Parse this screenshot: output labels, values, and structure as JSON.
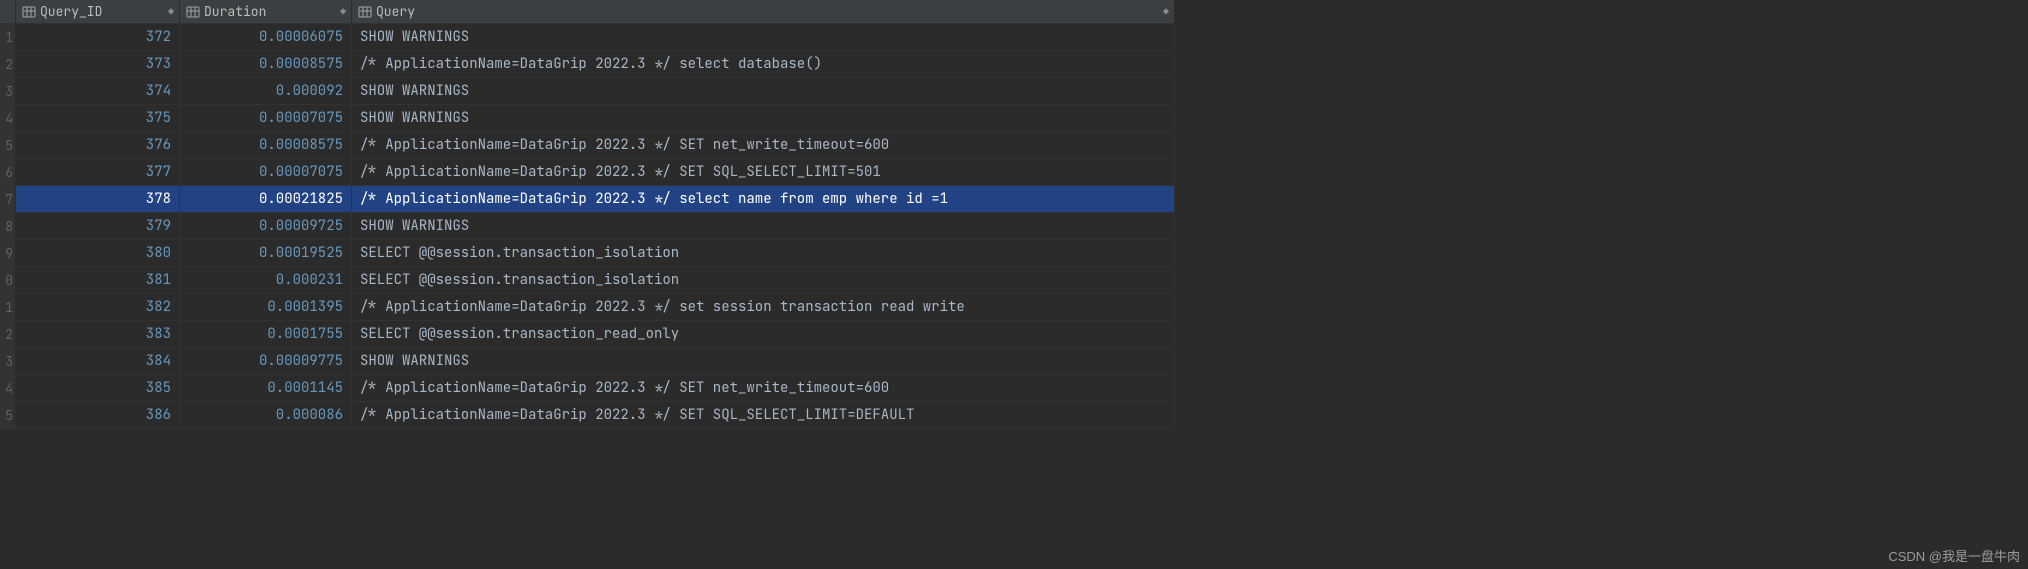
{
  "columns": {
    "query_id": {
      "label": "Query_ID",
      "sortable": true
    },
    "duration": {
      "label": "Duration",
      "sortable": true
    },
    "query": {
      "label": "Query",
      "sortable": true
    }
  },
  "selected_row_index": 6,
  "rows": [
    {
      "n": "1",
      "query_id": "372",
      "duration": "0.00006075",
      "query": "SHOW WARNINGS"
    },
    {
      "n": "2",
      "query_id": "373",
      "duration": "0.00008575",
      "query": "/* ApplicationName=DataGrip 2022.3 */ select database()"
    },
    {
      "n": "3",
      "query_id": "374",
      "duration": "0.000092",
      "query": "SHOW WARNINGS"
    },
    {
      "n": "4",
      "query_id": "375",
      "duration": "0.00007075",
      "query": "SHOW WARNINGS"
    },
    {
      "n": "5",
      "query_id": "376",
      "duration": "0.00008575",
      "query": "/* ApplicationName=DataGrip 2022.3 */ SET net_write_timeout=600"
    },
    {
      "n": "6",
      "query_id": "377",
      "duration": "0.00007075",
      "query": "/* ApplicationName=DataGrip 2022.3 */ SET SQL_SELECT_LIMIT=501"
    },
    {
      "n": "7",
      "query_id": "378",
      "duration": "0.00021825",
      "query": "/* ApplicationName=DataGrip 2022.3 */ select name from emp where id =1"
    },
    {
      "n": "8",
      "query_id": "379",
      "duration": "0.00009725",
      "query": "SHOW WARNINGS"
    },
    {
      "n": "9",
      "query_id": "380",
      "duration": "0.00019525",
      "query": "SELECT @@session.transaction_isolation"
    },
    {
      "n": "0",
      "query_id": "381",
      "duration": "0.000231",
      "query": "SELECT @@session.transaction_isolation"
    },
    {
      "n": "1",
      "query_id": "382",
      "duration": "0.0001395",
      "query": "/* ApplicationName=DataGrip 2022.3 */ set session transaction read write"
    },
    {
      "n": "2",
      "query_id": "383",
      "duration": "0.0001755",
      "query": "SELECT @@session.transaction_read_only"
    },
    {
      "n": "3",
      "query_id": "384",
      "duration": "0.00009775",
      "query": "SHOW WARNINGS"
    },
    {
      "n": "4",
      "query_id": "385",
      "duration": "0.0001145",
      "query": "/* ApplicationName=DataGrip 2022.3 */ SET net_write_timeout=600"
    },
    {
      "n": "5",
      "query_id": "386",
      "duration": "0.000086",
      "query": "/* ApplicationName=DataGrip 2022.3 */ SET SQL_SELECT_LIMIT=DEFAULT"
    }
  ],
  "watermark": "CSDN @我是一盘牛肉"
}
